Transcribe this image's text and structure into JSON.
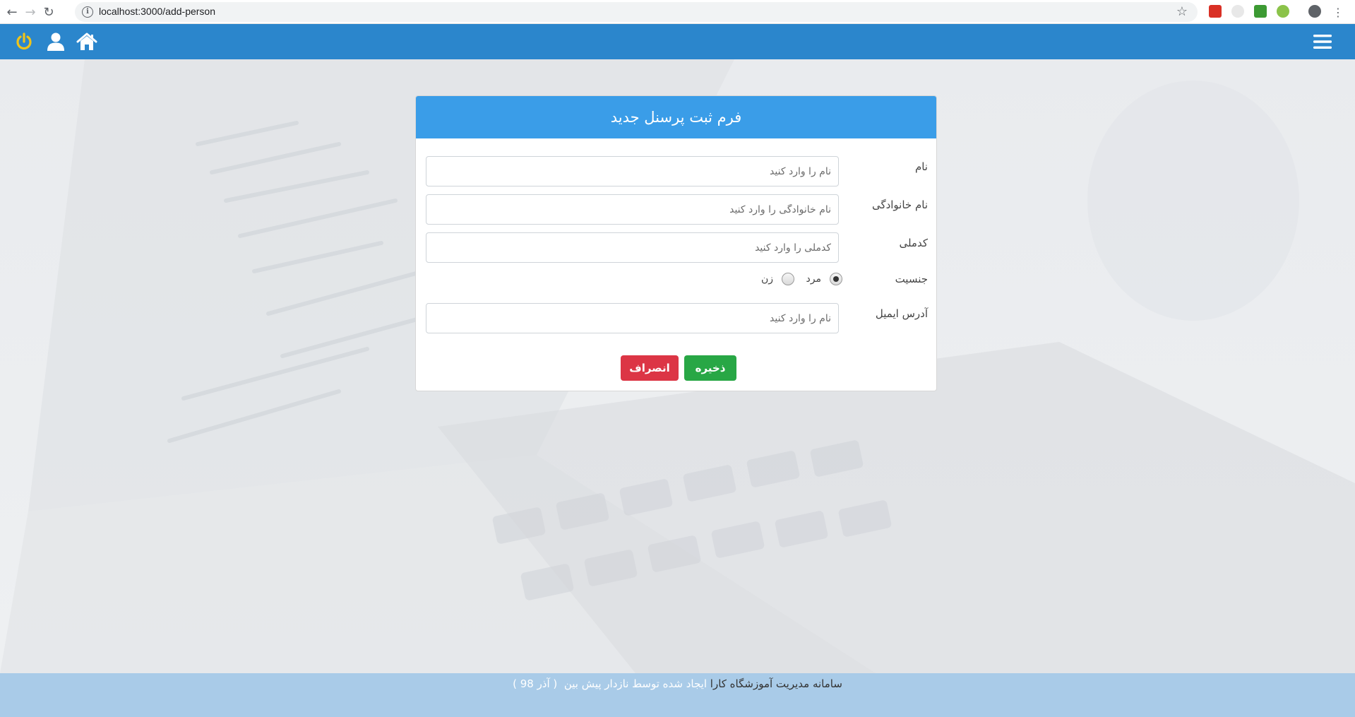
{
  "browser": {
    "url": "localhost:3000/add-person"
  },
  "app_bar": {
    "power_color": "#f0c419",
    "bar_color": "#2b86cc"
  },
  "form": {
    "title": "فرم ثبت پرسنل جدید",
    "fields": {
      "first_name": {
        "label": "نام",
        "placeholder": "نام را وارد کنید"
      },
      "last_name": {
        "label": "نام خانوادگی",
        "placeholder": "نام خانوادگی را وارد کنید"
      },
      "national_code": {
        "label": "کدملی",
        "placeholder": "کدملی را وارد کنید"
      },
      "email": {
        "label": "آدرس ایمیل",
        "placeholder": "نام را وارد کنید"
      }
    },
    "gender": {
      "label": "جنسیت",
      "options": [
        {
          "label": "مرد",
          "checked": true
        },
        {
          "label": "زن",
          "checked": false
        }
      ]
    },
    "save_label": "ذخیره",
    "cancel_label": "انصراف"
  },
  "footer": {
    "text_a": "سامانه مدیریت آموزشگاه کارا",
    "text_b": "ایجاد شده توسط نازدار پیش بین",
    "text_c": "( آذر 98 )"
  },
  "colors": {
    "header_blue": "#3a9de8",
    "save_green": "#28a745",
    "cancel_red": "#dc3545"
  }
}
